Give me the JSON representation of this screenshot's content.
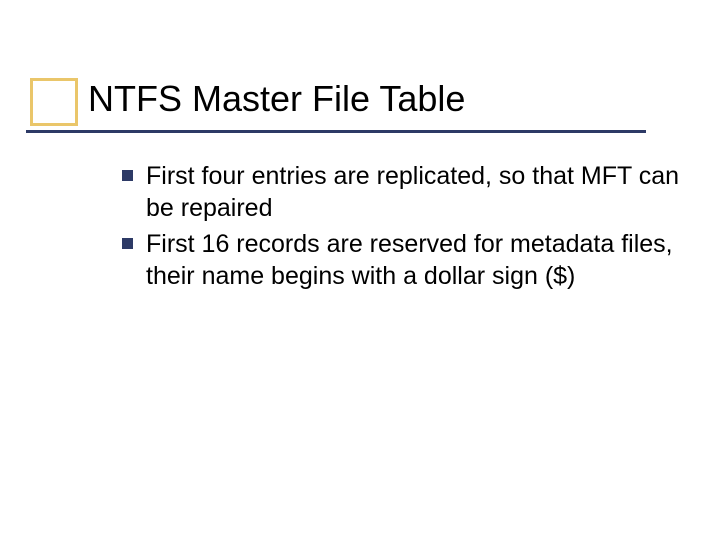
{
  "colors": {
    "accent_box": "#eac66a",
    "accent_line": "#2d3a66",
    "bullet": "#2d3a66"
  },
  "title": "NTFS Master File Table",
  "bullets": [
    "First four entries are replicated, so that MFT can be repaired",
    "First 16 records are reserved for metadata files, their name begins with a dollar sign ($)"
  ]
}
